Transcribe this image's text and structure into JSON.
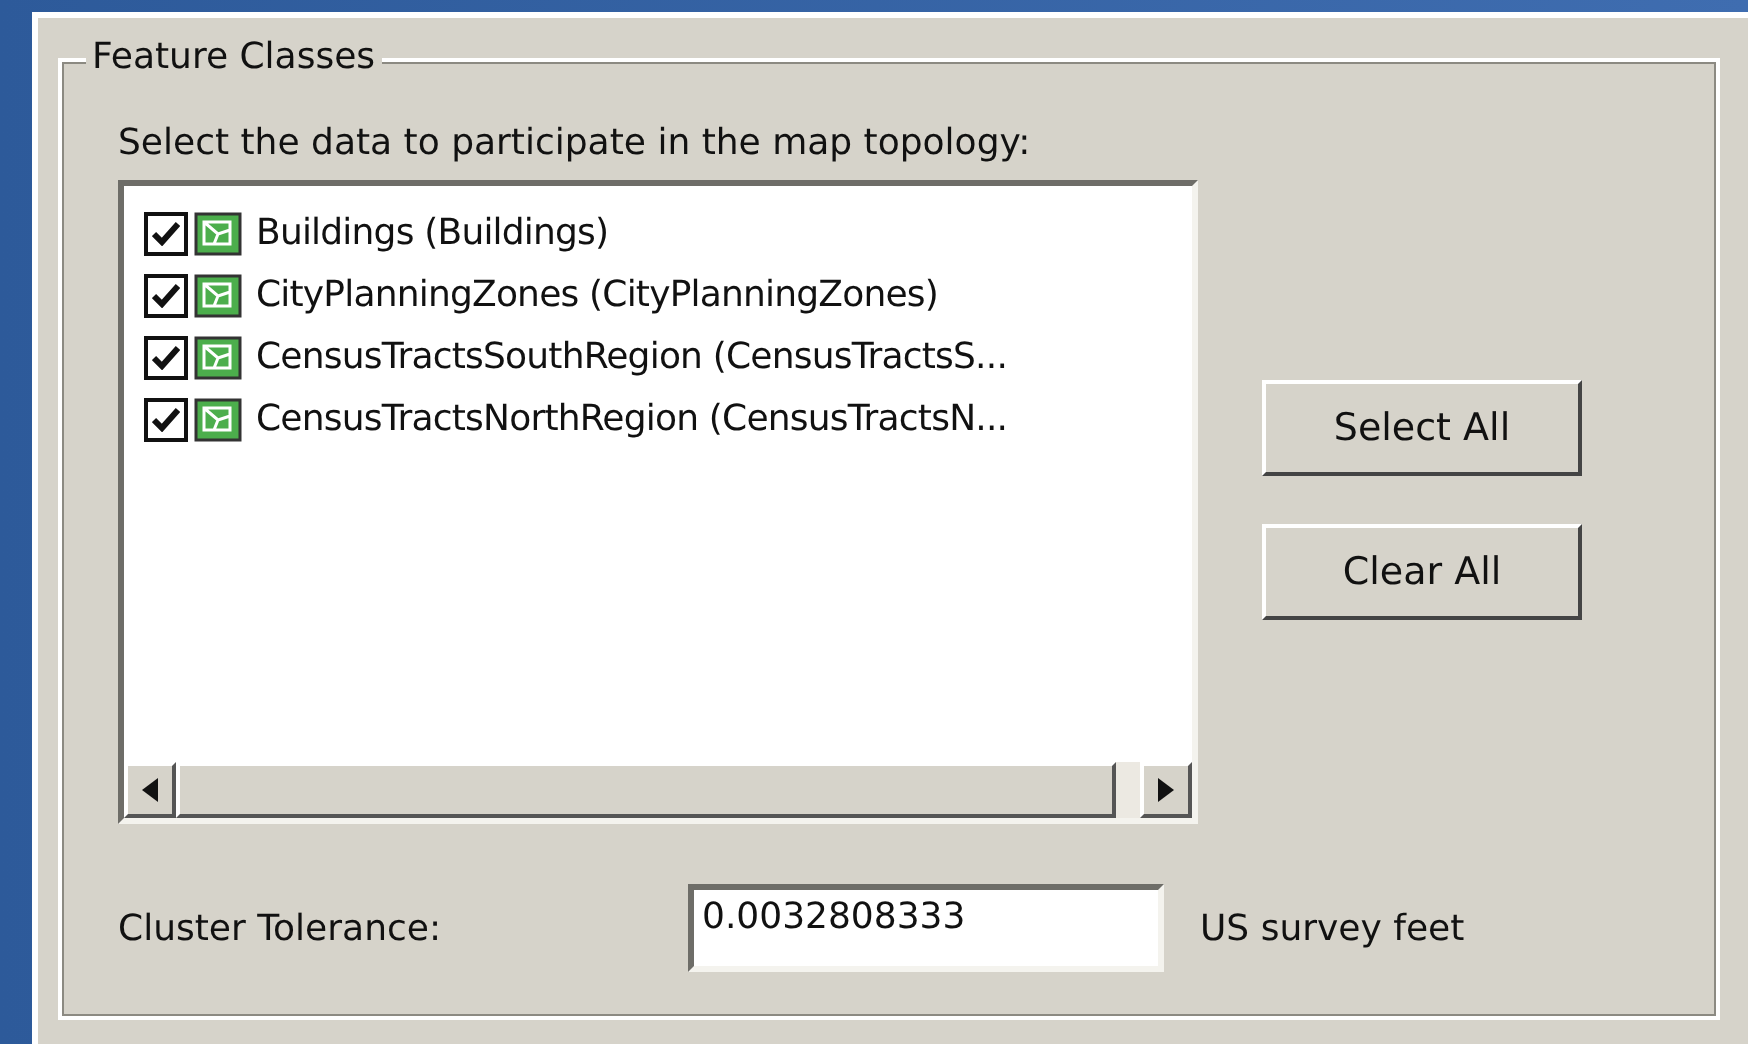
{
  "group": {
    "title": "Feature Classes"
  },
  "list_label": "Select the data to participate in the map topology:",
  "feature_classes": [
    {
      "label": "Buildings (Buildings)",
      "checked": true
    },
    {
      "label": "CityPlanningZones (CityPlanningZones)",
      "checked": true
    },
    {
      "label": "CensusTractsSouthRegion (CensusTractsS...",
      "checked": true
    },
    {
      "label": "CensusTractsNorthRegion (CensusTractsN...",
      "checked": true
    }
  ],
  "buttons": [
    "Select All",
    "Clear All"
  ],
  "cluster_tolerance": {
    "label": "Cluster Tolerance:",
    "value": "0.0032808333",
    "unit": "US survey feet"
  }
}
